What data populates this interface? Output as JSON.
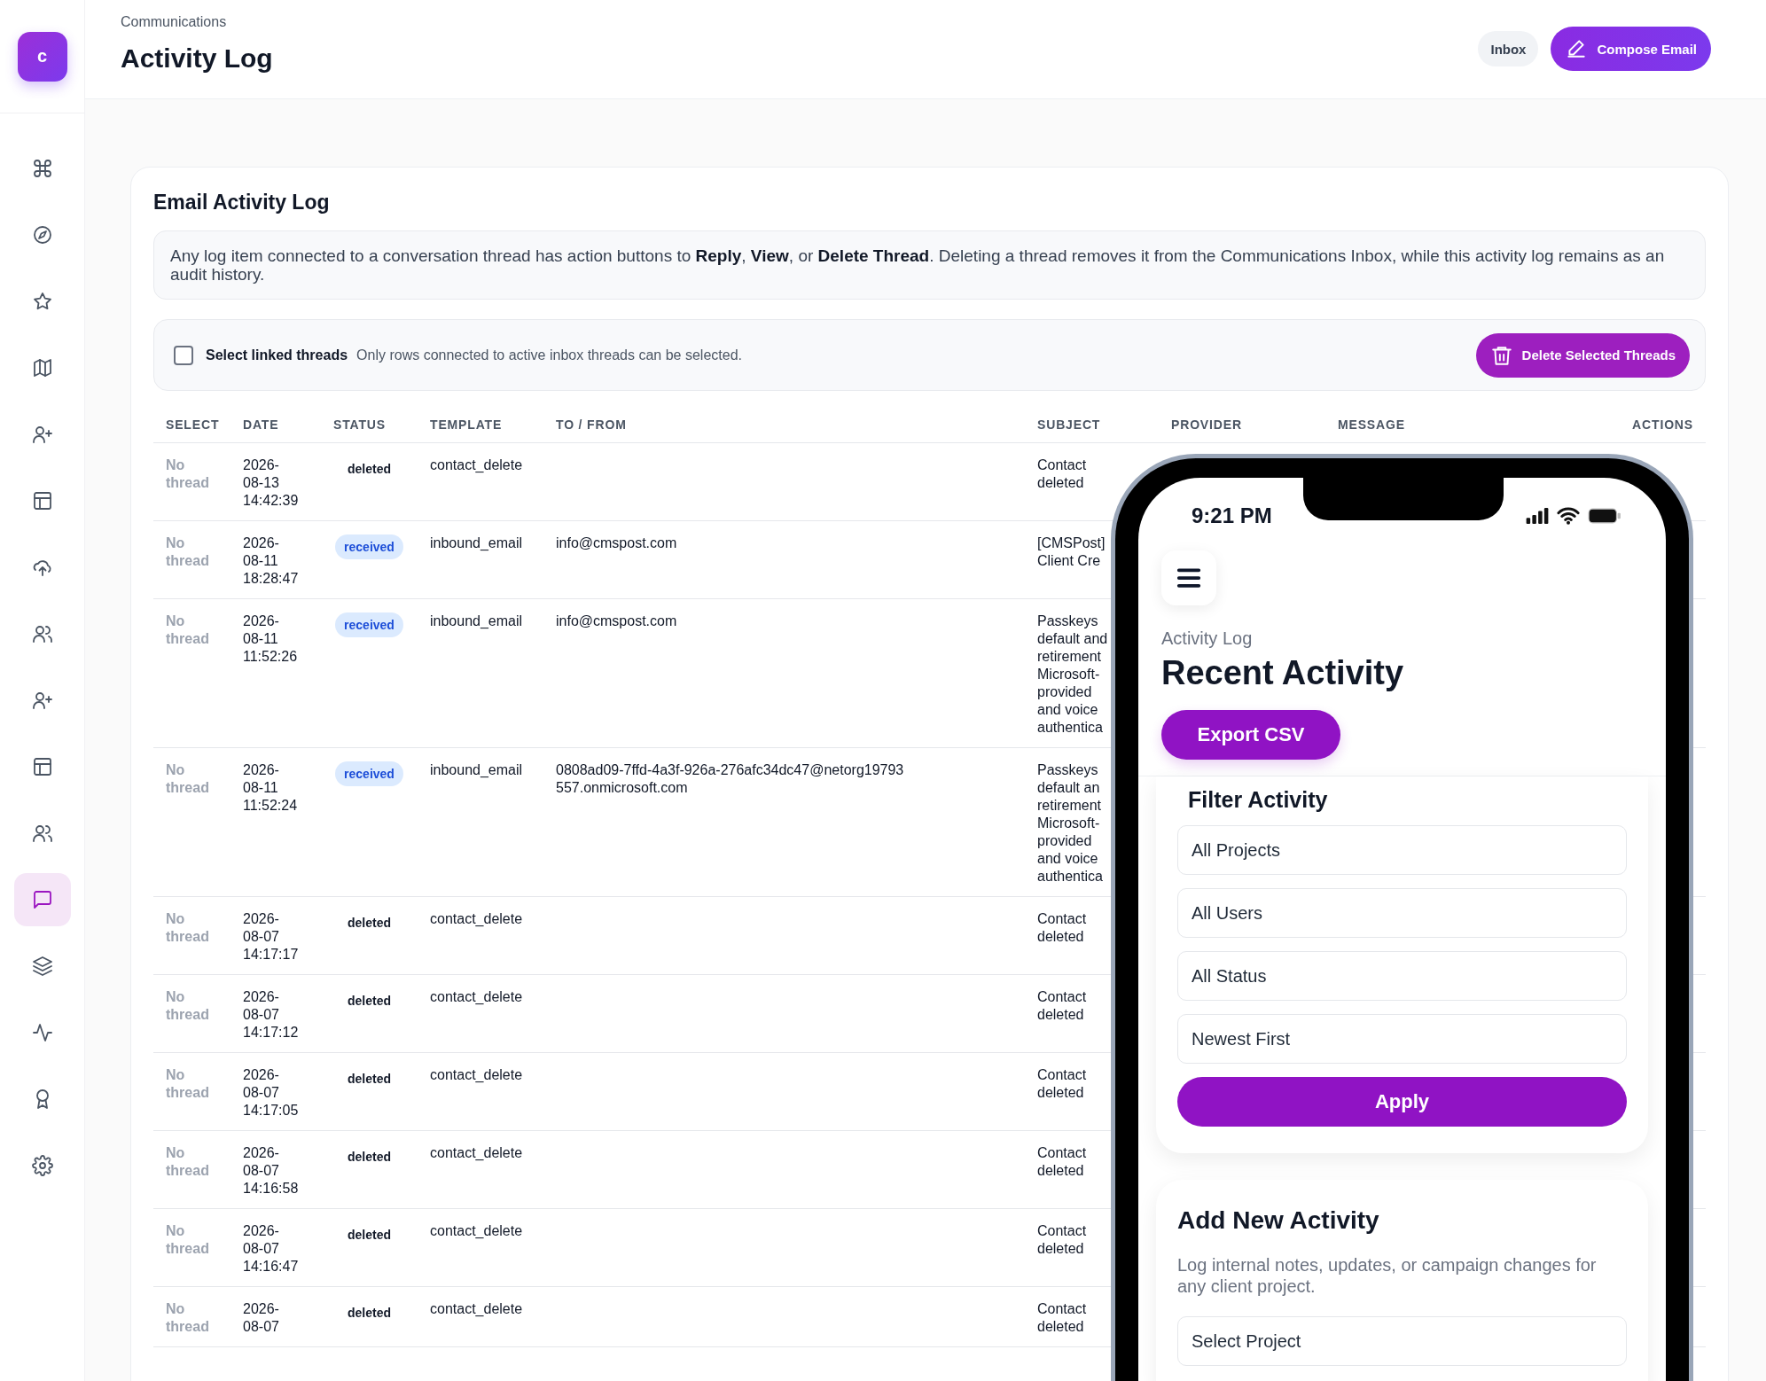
{
  "sidebar": {
    "logo": "c",
    "items": [
      {
        "kind": "command",
        "selected": false
      },
      {
        "kind": "compass",
        "selected": false
      },
      {
        "kind": "star",
        "selected": false
      },
      {
        "kind": "map",
        "selected": false
      },
      {
        "kind": "user-plus",
        "selected": false
      },
      {
        "kind": "layout",
        "selected": false
      },
      {
        "kind": "upload",
        "selected": false
      },
      {
        "kind": "users",
        "selected": false
      },
      {
        "kind": "user-plus",
        "selected": false
      },
      {
        "kind": "layout",
        "selected": false
      },
      {
        "kind": "users",
        "selected": false
      },
      {
        "kind": "message",
        "selected": true
      },
      {
        "kind": "layers",
        "selected": false
      },
      {
        "kind": "activity",
        "selected": false
      },
      {
        "kind": "award",
        "selected": false
      },
      {
        "kind": "settings",
        "selected": false
      }
    ]
  },
  "header": {
    "breadcrumb": "Communications",
    "title": "Activity Log",
    "buttons": [
      {
        "label": "Inbox",
        "kind": "secondary"
      },
      {
        "label": "Compose Email",
        "kind": "primary"
      }
    ]
  },
  "card": {
    "title": "Email Activity Log",
    "notice": "Any log item connected to a conversation thread has action buttons to **Reply**, **View**, or **Delete Thread**. Deleting a thread removes it from the Communications Inbox, while this activity log remains as an audit history.",
    "select_bar": {
      "label": "Select linked threads",
      "checked": false,
      "hint": "Only rows connected to active inbox threads can be selected.",
      "button": "Delete Selected Threads"
    },
    "table": {
      "columns": [
        "SELECT",
        "DATE",
        "STATUS",
        "TEMPLATE",
        "TO / FROM",
        "SUBJECT",
        "PROVIDER",
        "MESSAGE",
        "ACTIONS"
      ],
      "rows": [
        {
          "select": "No thread",
          "date": "2026-08-13 14:42:39",
          "status": "deleted",
          "badge": false,
          "template": "contact_delete",
          "to_from": "",
          "subject": "Contact\ndeleted"
        },
        {
          "select": "No thread",
          "date": "2026-08-11 18:28:47",
          "status": "received",
          "badge": true,
          "template": "inbound_email",
          "to_from": "info@cmspost.com",
          "subject": "[CMSPost]\nClient Cre"
        },
        {
          "select": "No thread",
          "date": "2026-08-11 11:52:26",
          "status": "received",
          "badge": true,
          "template": "inbound_email",
          "to_from": "info@cmspost.com",
          "subject": "Passkeys\ndefault and\nretirement\nMicrosoft-\nprovided\nand voice\nauthentica"
        },
        {
          "select": "No thread",
          "date": "2026-08-11 11:52:24",
          "status": "received",
          "badge": true,
          "template": "inbound_email",
          "to_from": "0808ad09-7ffd-4a3f-926a-276afc34dc47@netorg19793557.onmicrosoft.com",
          "subject": "Passkeys\ndefault an\nretirement\nMicrosoft-\nprovided\nand voice\nauthentica"
        },
        {
          "select": "No thread",
          "date": "2026-08-07 14:17:17",
          "status": "deleted",
          "badge": false,
          "template": "contact_delete",
          "to_from": "",
          "subject": "Contact\ndeleted"
        },
        {
          "select": "No thread",
          "date": "2026-08-07 14:17:12",
          "status": "deleted",
          "badge": false,
          "template": "contact_delete",
          "to_from": "",
          "subject": "Contact\ndeleted"
        },
        {
          "select": "No thread",
          "date": "2026-08-07 14:17:05",
          "status": "deleted",
          "badge": false,
          "template": "contact_delete",
          "to_from": "",
          "subject": "Contact\ndeleted"
        },
        {
          "select": "No thread",
          "date": "2026-08-07 14:16:58",
          "status": "deleted",
          "badge": false,
          "template": "contact_delete",
          "to_from": "",
          "subject": "Contact\ndeleted"
        },
        {
          "select": "No thread",
          "date": "2026-08-07 14:16:47",
          "status": "deleted",
          "badge": false,
          "template": "contact_delete",
          "to_from": "",
          "subject": "Contact\ndeleted"
        },
        {
          "select": "No thread",
          "date": "2026-08-07",
          "status": "deleted",
          "badge": false,
          "template": "contact_delete",
          "to_from": "",
          "subject": "Contact\ndeleted"
        }
      ]
    }
  },
  "phone": {
    "time": "9:21 PM",
    "subtitle": "Activity Log",
    "title": "Recent Activity",
    "export_button": "Export CSV",
    "filter": {
      "title": "Filter Activity",
      "fields": [
        {
          "value": "All Projects"
        },
        {
          "value": "All Users"
        },
        {
          "value": "All Status"
        },
        {
          "value": "Newest First"
        }
      ],
      "button": "Apply"
    },
    "add": {
      "title": "Add New Activity",
      "description": "Log internal notes, updates, or campaign changes for any client project.",
      "field": {
        "value": "Select Project"
      }
    }
  }
}
